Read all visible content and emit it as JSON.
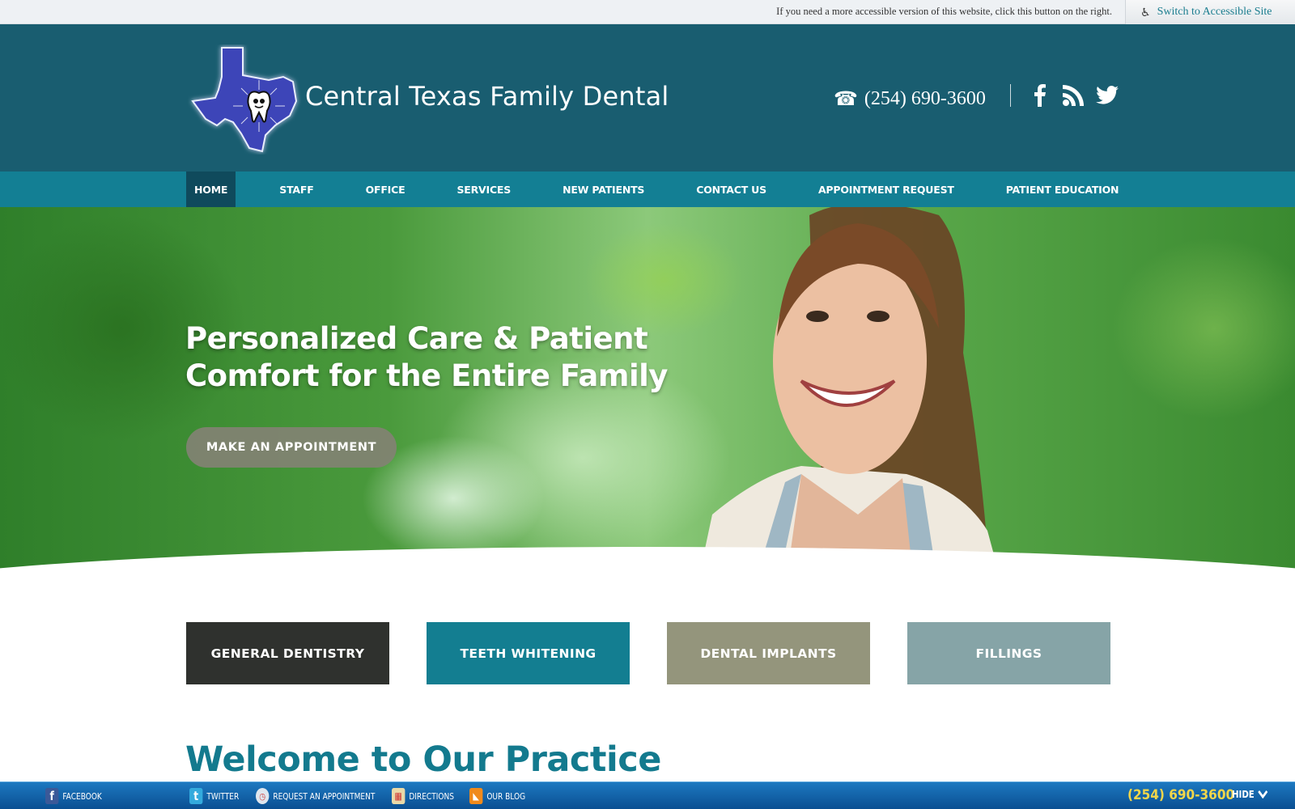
{
  "accessibility_bar": {
    "message": "If you need a more accessible version of this website, click this button on the right.",
    "button_label": "Switch to Accessible Site",
    "button_icon": "wheelchair-icon"
  },
  "header": {
    "brand_name": "Central Texas Family Dental",
    "logo_icon": "texas-tooth-logo",
    "phone": "(254) 690-3600",
    "phone_icon": "telephone-icon",
    "social": [
      {
        "name": "Facebook",
        "icon": "facebook-icon"
      },
      {
        "name": "RSS",
        "icon": "rss-icon"
      },
      {
        "name": "Twitter",
        "icon": "twitter-icon"
      }
    ]
  },
  "nav": {
    "items": [
      {
        "label": "HOME",
        "active": true
      },
      {
        "label": "STAFF"
      },
      {
        "label": "OFFICE"
      },
      {
        "label": "SERVICES"
      },
      {
        "label": "NEW PATIENTS"
      },
      {
        "label": "CONTACT US"
      },
      {
        "label": "APPOINTMENT REQUEST"
      },
      {
        "label": "PATIENT EDUCATION"
      }
    ]
  },
  "hero": {
    "headline_line1": "Personalized Care & Patient",
    "headline_line2": "Comfort for the Entire Family",
    "cta_label": "MAKE AN APPOINTMENT"
  },
  "services": [
    {
      "label": "GENERAL DENTISTRY",
      "color": "#2f312e"
    },
    {
      "label": "TEETH WHITENING",
      "color": "#137e91"
    },
    {
      "label": "DENTAL IMPLANTS",
      "color": "#94957c"
    },
    {
      "label": "FILLINGS",
      "color": "#86a4a7"
    }
  ],
  "welcome_heading": "Welcome to Our Practice",
  "bottom_bar": {
    "items": [
      {
        "label": "FACEBOOK",
        "icon": "facebook-icon"
      },
      {
        "label": "TWITTER",
        "icon": "twitter-icon"
      },
      {
        "label": "REQUEST AN APPOINTMENT",
        "icon": "clock-icon"
      },
      {
        "label": "DIRECTIONS",
        "icon": "map-icon"
      },
      {
        "label": "OUR BLOG",
        "icon": "rss-icon"
      }
    ],
    "phone": "(254) 690-3600",
    "hide_label": "HIDE"
  }
}
